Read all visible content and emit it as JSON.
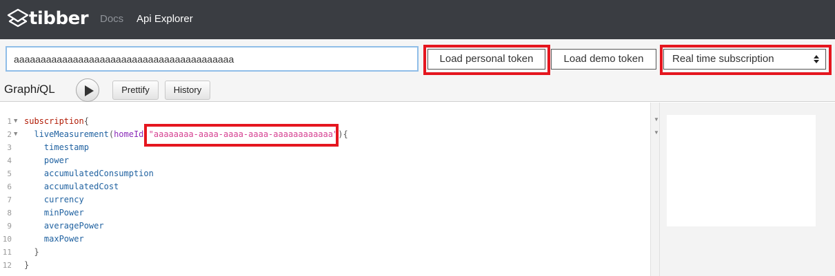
{
  "nav": {
    "brand": "tibber",
    "docs": "Docs",
    "api_explorer": "Api Explorer"
  },
  "token_bar": {
    "token_value": "aaaaaaaaaaaaaaaaaaaaaaaaaaaaaaaaaaaaaaaaa",
    "load_personal_token": "Load personal token",
    "load_demo_token": "Load demo token",
    "subscription_select": "Real time subscription"
  },
  "graphiql": {
    "title_pre": "Graph",
    "title_i": "i",
    "title_post": "QL",
    "prettify": "Prettify",
    "history": "History"
  },
  "editor": {
    "lines": [
      {
        "n": "1",
        "fold": true
      },
      {
        "n": "2",
        "fold": true
      },
      {
        "n": "3",
        "fold": false
      },
      {
        "n": "4",
        "fold": false
      },
      {
        "n": "5",
        "fold": false
      },
      {
        "n": "6",
        "fold": false
      },
      {
        "n": "7",
        "fold": false
      },
      {
        "n": "8",
        "fold": false
      },
      {
        "n": "9",
        "fold": false
      },
      {
        "n": "10",
        "fold": false
      },
      {
        "n": "11",
        "fold": false
      },
      {
        "n": "12",
        "fold": false
      }
    ],
    "code": {
      "subscription": "subscription",
      "open_brace": "{",
      "live_measurement": "liveMeasurement",
      "paren_open": "(",
      "home_id_arg": "homeId",
      "colon": ":",
      "home_id_value": "\"aaaaaaaa-aaaa-aaaa-aaaa-aaaaaaaaaaaa\"",
      "paren_close": ")",
      "inner_open": "{",
      "fields": [
        "timestamp",
        "power",
        "accumulatedConsumption",
        "accumulatedCost",
        "currency",
        "minPower",
        "averagePower",
        "maxPower"
      ],
      "inner_close": "}",
      "outer_close": "}"
    }
  },
  "colors": {
    "highlight": "#e5161f",
    "topbar": "#3a3d42"
  },
  "icons": {
    "logo": "tibber-logo-icon",
    "play": "play-icon",
    "select_arrows": "updown-arrows-icon"
  }
}
